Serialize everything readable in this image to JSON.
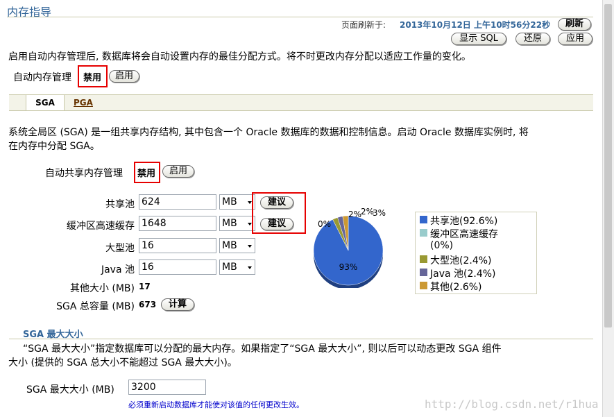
{
  "page": {
    "title": "内存指导",
    "refresh_label": "页面刷新于:",
    "refresh_time": "2013年10月12日 上午10时56分22秒",
    "buttons": {
      "refresh": "刷新",
      "show_sql": "显示 SQL",
      "revert": "还原",
      "apply": "应用"
    },
    "intro": "启用自动内存管理后, 数据库将会自动设置内存的最佳分配方式。将不时更改内存分配以适应工作量的变化。",
    "auto_mem_label": "自动内存管理",
    "auto_mem_state": "禁用",
    "auto_mem_enable_btn": "启用"
  },
  "tabs": [
    {
      "label": "SGA"
    },
    {
      "label": "PGA"
    }
  ],
  "sga": {
    "desc_line1": "系统全局区 (SGA) 是一组共享内存结构, 其中包含一个 Oracle 数据库的数据和控制信息。启动 Oracle 数据库实例时, 将",
    "desc_line2": "在内存中分配 SGA。",
    "auto_shared_label": "自动共享内存管理",
    "auto_shared_state": "禁用",
    "auto_shared_enable_btn": "启用",
    "rows": [
      {
        "label": "共享池",
        "value": "624",
        "unit": "MB",
        "advice": "建议"
      },
      {
        "label": "缓冲区高速缓存",
        "value": "1648",
        "unit": "MB",
        "advice": "建议"
      },
      {
        "label": "大型池",
        "value": "16",
        "unit": "MB"
      },
      {
        "label": "Java 池",
        "value": "16",
        "unit": "MB"
      }
    ],
    "other_label": "其他大小 (MB)",
    "other_value": "17",
    "total_label": "SGA 总容量 (MB)",
    "total_value": "673",
    "compute_btn": "计算"
  },
  "chart_data": {
    "type": "pie",
    "slices": [
      {
        "name": "共享池(92.6%)",
        "value": 92.6,
        "color": "#3366cc"
      },
      {
        "name": "缓冲区高速缓存(0%)",
        "value": 0,
        "color": "#99cccc"
      },
      {
        "name": "大型池(2.4%)",
        "value": 2.4,
        "color": "#999933"
      },
      {
        "name": "Java 池(2.4%)",
        "value": 2.4,
        "color": "#666699"
      },
      {
        "name": "其他(2.6%)",
        "value": 2.6,
        "color": "#cc9933"
      }
    ],
    "data_labels": [
      "93%",
      "0%",
      "2%",
      "2%",
      "3%"
    ],
    "legend": [
      "共享池(92.6%)",
      "缓冲区高速缓存",
      "(0%)",
      "大型池(2.4%)",
      "Java 池(2.4%)",
      "其他(2.6%)"
    ]
  },
  "sga_max": {
    "heading": "SGA 最大大小",
    "desc_line1": "“SGA 最大大小”指定数据库可以分配的最大内存。如果指定了“SGA 最大大小”, 则以后可以动态更改 SGA 组件",
    "desc_line2": "大小 (提供的 SGA 总大小不能超过 SGA 最大大小)。",
    "label": "SGA 最大大小 (MB)",
    "value": "3200",
    "note": "必须重新启动数据库才能使对该值的任何更改生效。"
  },
  "watermark": "http://blog.csdn.net/r1hua"
}
